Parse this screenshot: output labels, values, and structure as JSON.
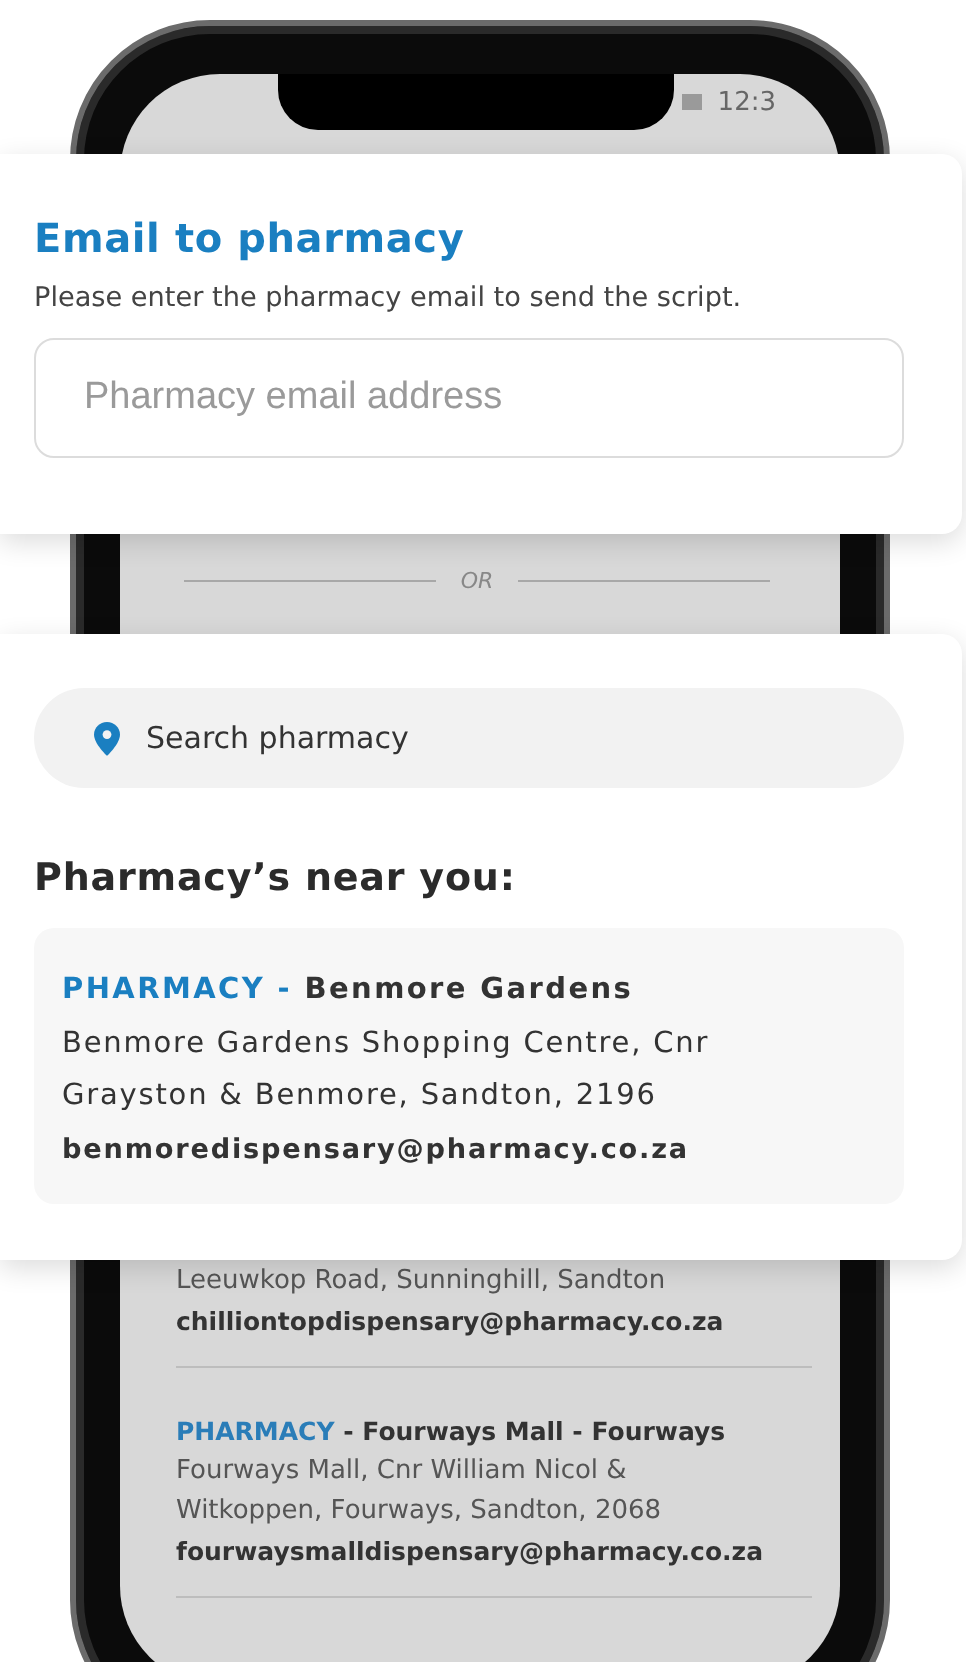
{
  "phone_screen": {
    "status_time": "12:3",
    "divider_label": "OR",
    "pharmacies": [
      {
        "address": "Leeuwkop Road, Sunninghill, Sandton",
        "email": "chilliontopdispensary@pharmacy.co.za"
      },
      {
        "brand": "PHARMACY",
        "name": "- Fourways Mall - Fourways",
        "address": "Fourways Mall, Cnr William Nicol & Witkoppen, Fourways, Sandton, 2068",
        "email": "fourwaysmalldispensary@pharmacy.co.za"
      }
    ]
  },
  "email_card": {
    "title": "Email to pharmacy",
    "description": "Please enter the pharmacy email to send the script.",
    "email_field": {
      "placeholder": "Pharmacy email address"
    }
  },
  "search_card": {
    "search_field": {
      "placeholder": "Search pharmacy"
    },
    "heading": "Pharmacy’s near you:",
    "results": [
      {
        "brand": "PHARMACY -",
        "name": "Benmore Gardens",
        "address": "Benmore Gardens Shopping Centre, Cnr Grayston & Benmore, Sandton, 2196",
        "email": "benmoredispensary@pharmacy.co.za"
      }
    ]
  }
}
